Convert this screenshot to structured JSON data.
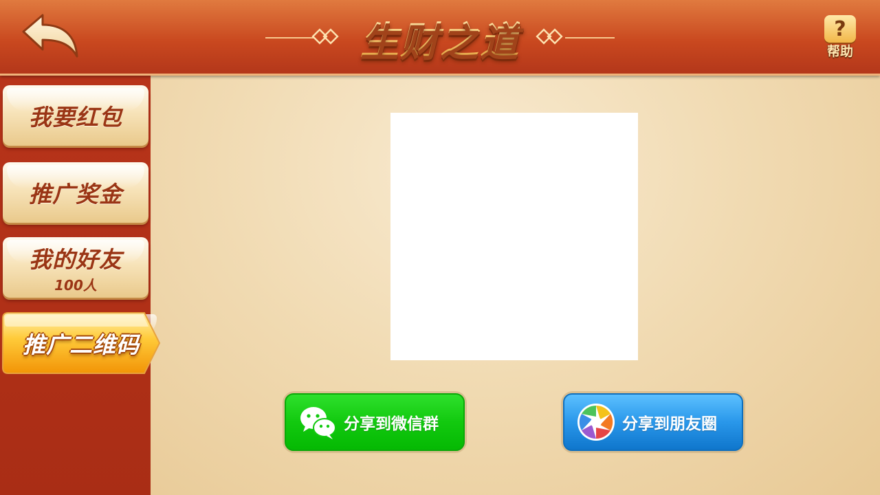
{
  "header": {
    "title": "生财之道",
    "help_label": "帮助",
    "help_symbol": "?",
    "back_icon": "back-arrow-icon"
  },
  "sidebar": {
    "items": [
      {
        "label": "我要红包",
        "sub": "",
        "active": false
      },
      {
        "label": "推广奖金",
        "sub": "",
        "active": false
      },
      {
        "label": "我的好友",
        "sub": "100人",
        "active": false
      },
      {
        "label": "推广二维码",
        "sub": "",
        "active": true
      }
    ]
  },
  "main": {
    "share_wechat_label": "分享到微信群",
    "share_moments_label": "分享到朋友圈"
  },
  "colors": {
    "header_red": "#c9481f",
    "sidebar_red": "#b8341a",
    "panel_beige": "#f1dbb3",
    "wechat_green": "#12c90f",
    "moments_blue": "#2997ea",
    "active_orange": "#f6a514"
  }
}
